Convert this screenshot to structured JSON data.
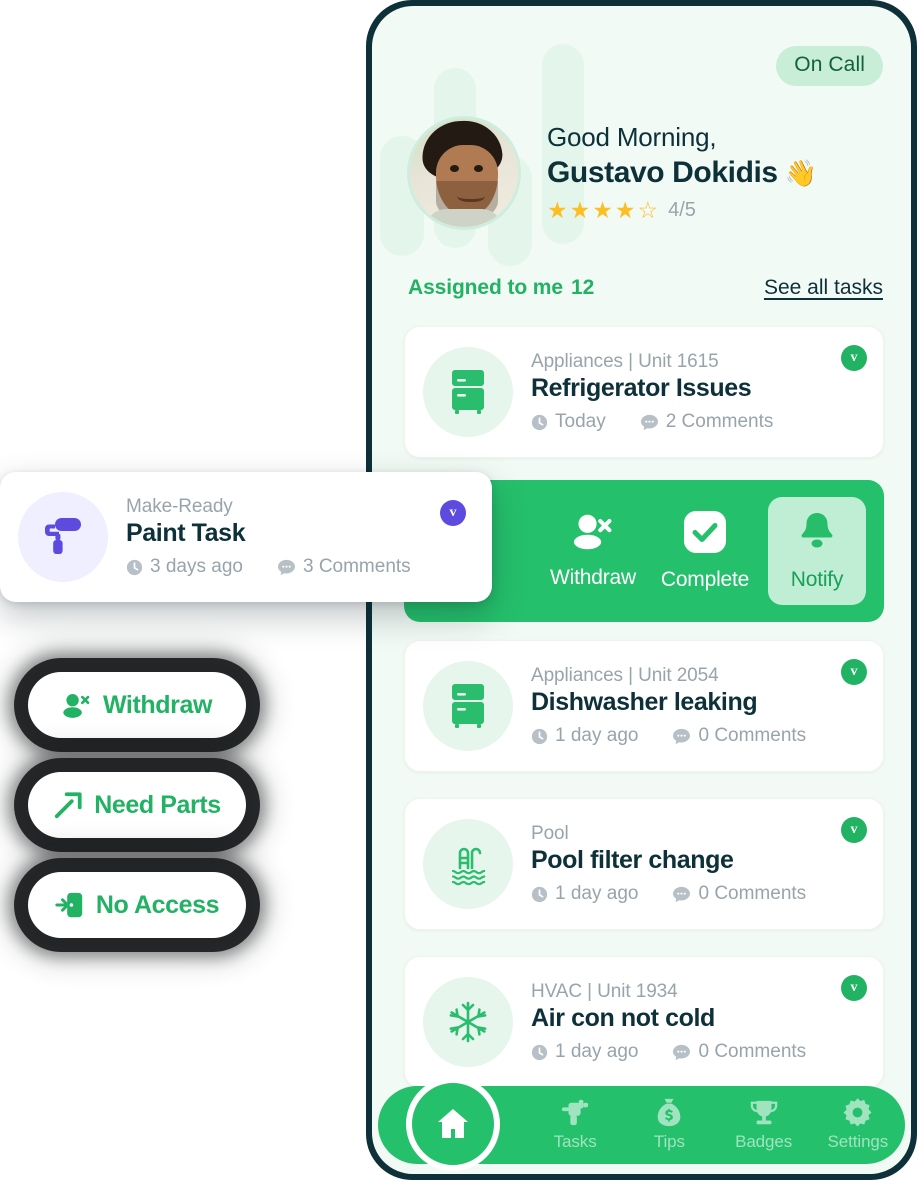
{
  "app": {
    "status_badge": "On Call",
    "greeting": "Good Morning,",
    "user_name": "Gustavo Dokidis",
    "wave_emoji": "👋",
    "rating_value": "4/5",
    "rating_filled": 4,
    "rating_total": 5,
    "avatar_alt": "user-avatar"
  },
  "assigned": {
    "label": "Assigned to me",
    "count": "12",
    "see_all": "See all tasks"
  },
  "tasks": [
    {
      "category": "Appliances | Unit 1615",
      "title": "Refrigerator Issues",
      "time": "Today",
      "comments": "2 Comments",
      "badge": "v",
      "icon": "refrigerator-icon"
    },
    {
      "category": "Appliances | Unit 2054",
      "title": "Dishwasher leaking",
      "time": "1 day ago",
      "comments": "0 Comments",
      "badge": "v",
      "icon": "refrigerator-icon"
    },
    {
      "category": "Pool",
      "title": "Pool filter change",
      "time": "1 day ago",
      "comments": "0 Comments",
      "badge": "v",
      "icon": "pool-ladder-icon"
    },
    {
      "category": "HVAC | Unit 1934",
      "title": "Air con not cold",
      "time": "1 day ago",
      "comments": "0 Comments",
      "badge": "v",
      "icon": "snowflake-icon"
    }
  ],
  "action_bar": {
    "withdraw": "Withdraw",
    "complete": "Complete",
    "notify": "Notify",
    "active": "Notify"
  },
  "paint_card": {
    "category": "Make-Ready",
    "title": "Paint Task",
    "time": "3 days ago",
    "comments": "3 Comments",
    "badge": "v",
    "icon": "paint-roller-icon"
  },
  "action_stack": [
    {
      "label": "Withdraw",
      "icon": "person-remove-icon"
    },
    {
      "label": "Need Parts",
      "icon": "hammer-icon"
    },
    {
      "label": "No Access",
      "icon": "door-exit-icon"
    }
  ],
  "bottom_nav": [
    {
      "label": "Home",
      "icon": "home-icon",
      "active": true
    },
    {
      "label": "Tasks",
      "icon": "drill-icon",
      "active": false
    },
    {
      "label": "Tips",
      "icon": "money-bag-icon",
      "active": false
    },
    {
      "label": "Badges",
      "icon": "trophy-icon",
      "active": false
    },
    {
      "label": "Settings",
      "icon": "gear-icon",
      "active": false
    }
  ],
  "colors": {
    "brand_green": "#22b264",
    "bar_green": "#25c06c",
    "mint_bg": "#e6f6ec",
    "screen_bg": "#f2faf5",
    "frame_navy": "#0d3039",
    "purple": "#5d4be0",
    "star_gold": "#fbbf24",
    "muted_text": "#98a4ab"
  }
}
